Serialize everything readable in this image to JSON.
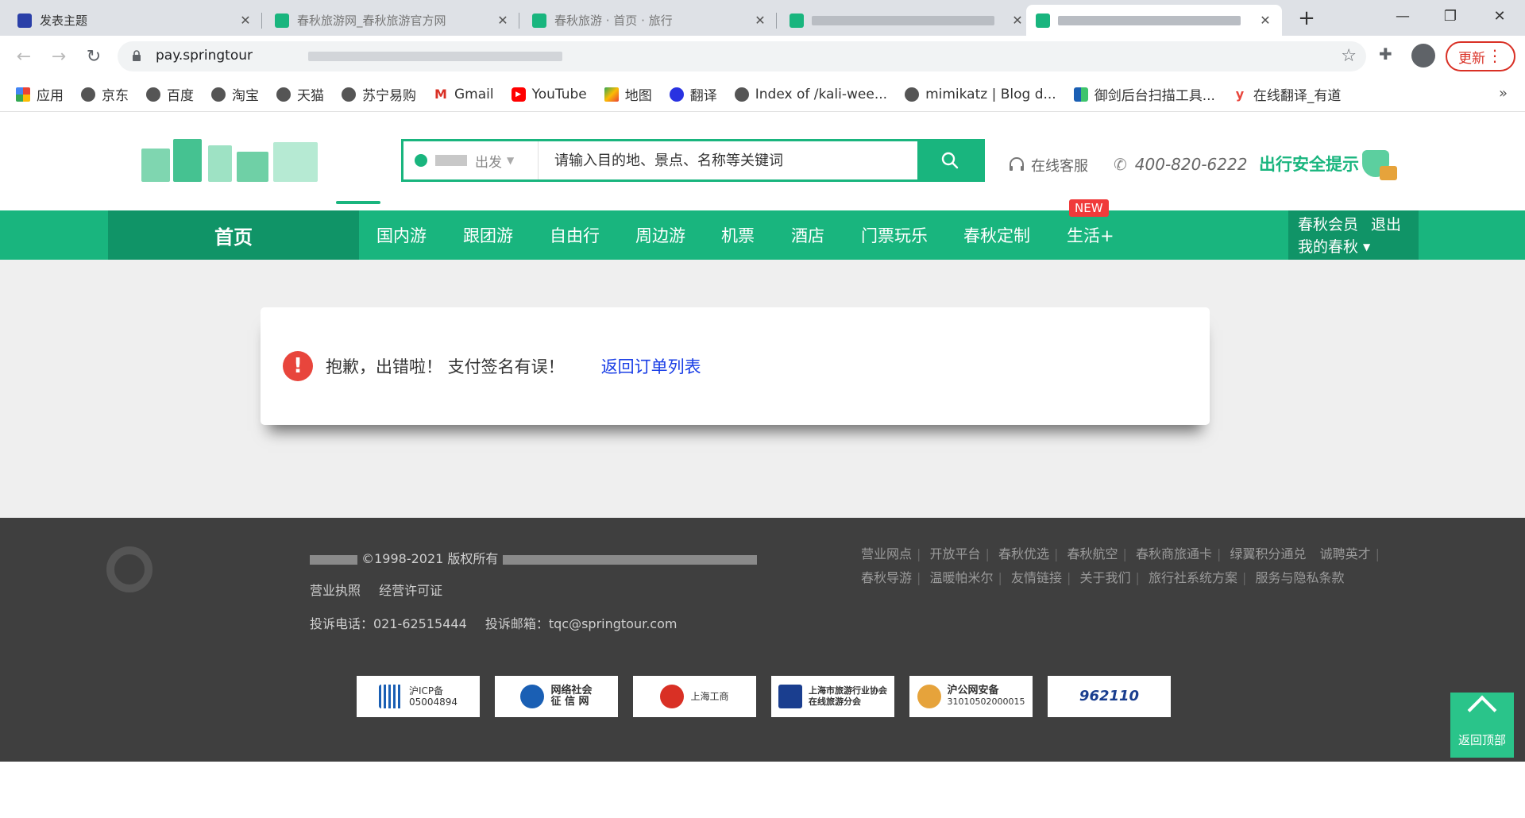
{
  "browser": {
    "tabs": [
      {
        "title": "发表主题"
      },
      {
        "title": "春秋旅游网_春秋旅游官方网"
      },
      {
        "title": "春秋旅游 · 首页 · 旅行"
      },
      {
        "title": ""
      },
      {
        "title": ""
      }
    ],
    "url": "pay.springtour",
    "update_label": "更新",
    "bookmarks": [
      {
        "label": "应用",
        "icon": "apps-grid-icon"
      },
      {
        "label": "京东",
        "icon": "globe-icon"
      },
      {
        "label": "百度",
        "icon": "globe-icon"
      },
      {
        "label": "淘宝",
        "icon": "globe-icon"
      },
      {
        "label": "天猫",
        "icon": "globe-icon"
      },
      {
        "label": "苏宁易购",
        "icon": "globe-icon"
      },
      {
        "label": "Gmail",
        "icon": "gmail-icon"
      },
      {
        "label": "YouTube",
        "icon": "youtube-icon"
      },
      {
        "label": "地图",
        "icon": "maps-icon"
      },
      {
        "label": "翻译",
        "icon": "baidu-paw-icon"
      },
      {
        "label": "Index of /kali-wee...",
        "icon": "globe-icon"
      },
      {
        "label": "mimikatz | Blog d...",
        "icon": "globe-icon"
      },
      {
        "label": "御剑后台扫描工具...",
        "icon": "shield-icon"
      },
      {
        "label": "在线翻译_有道",
        "icon": "youdao-icon"
      }
    ],
    "more": "»"
  },
  "header": {
    "departure_suffix": "出发",
    "search_placeholder": "请输入目的地、景点、名称等关键词",
    "service": "在线客服",
    "hotline": "400-820-6222",
    "safety": "出行安全提示"
  },
  "nav": {
    "home": "首页",
    "items": [
      "国内游",
      "跟团游",
      "自由行",
      "周边游",
      "机票",
      "酒店",
      "门票玩乐",
      "春秋定制",
      "生活+"
    ],
    "new_badge": "NEW",
    "member": "春秋会员",
    "logout": "退出",
    "my": "我的春秋"
  },
  "main": {
    "error_icon": "!",
    "message": "抱歉，出错啦！ 支付签名有误！",
    "back_link": "返回订单列表"
  },
  "footer": {
    "copyright": "©1998-2021 版权所有",
    "license_links": [
      "营业执照",
      "经营许可证"
    ],
    "complaint_phone": "投诉电话：021-62515444",
    "complaint_email": "投诉邮箱：tqc@springtour.com",
    "links_row1": [
      "营业网点",
      "开放平台",
      "春秋优选",
      "春秋航空",
      "春秋商旅通卡",
      "绿翼积分通兑",
      "诚聘英才"
    ],
    "links_row2": [
      "春秋导游",
      "温暖帕米尔",
      "友情链接",
      "关于我们",
      "旅行社系统方案",
      "服务与隐私条款"
    ],
    "badges": [
      {
        "line1": "沪ICP备",
        "line2": "05004894"
      },
      {
        "line1": "网络社会",
        "line2": "征 信 网"
      },
      {
        "line1": "上海工商",
        "line2": ""
      },
      {
        "line1": "上海市旅游行业协会",
        "line2": "在线旅游分会"
      },
      {
        "line1": "沪公网安备",
        "line2": "31010502000015"
      },
      {
        "line1": "962110",
        "line2": ""
      }
    ]
  },
  "back_to_top": "返回顶部",
  "colors": {
    "brand_green": "#19b57e",
    "dark_green": "#109467",
    "error_red": "#e8453c",
    "link_blue": "#1a3ee6"
  }
}
